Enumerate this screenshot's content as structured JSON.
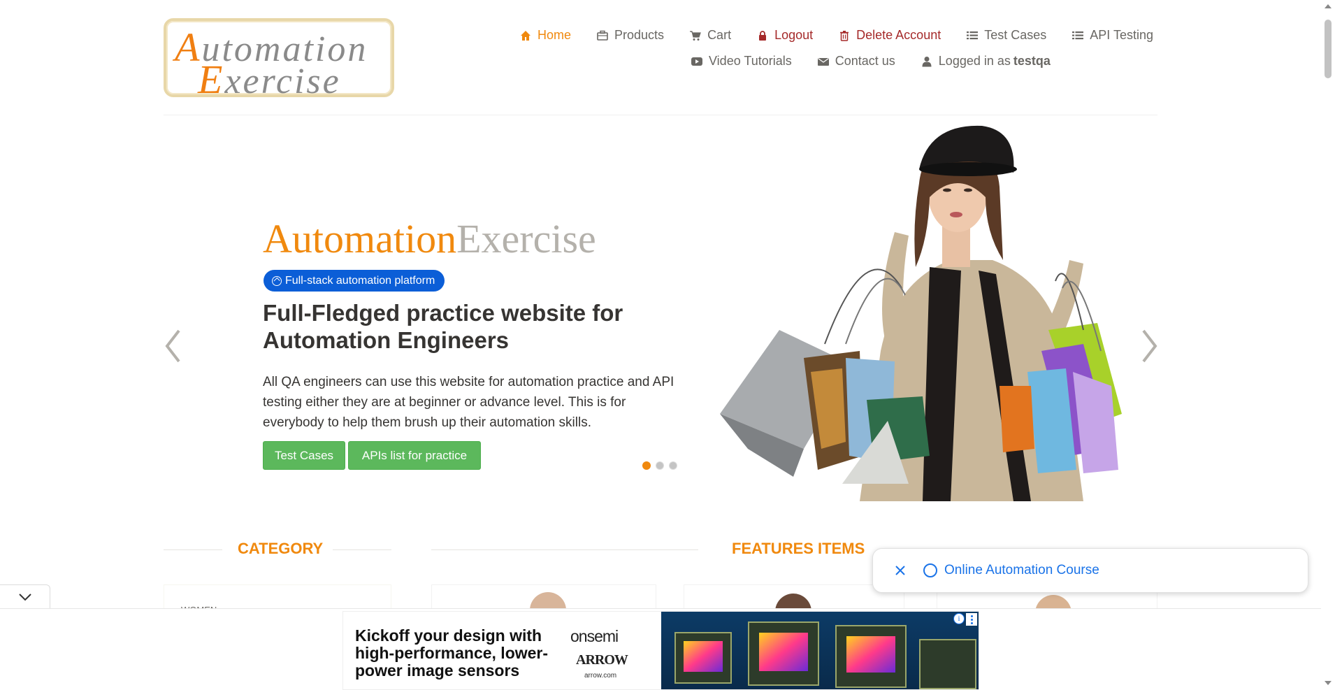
{
  "header": {
    "logo": {
      "line1_cap": "A",
      "line1_rest": "utomation",
      "line2_cap": "E",
      "line2_rest": "xercise"
    },
    "nav_row1": [
      {
        "label": "Home",
        "icon": "home-icon"
      },
      {
        "label": "Products",
        "icon": "briefcase-icon"
      },
      {
        "label": "Cart",
        "icon": "cart-icon"
      },
      {
        "label": "Logout",
        "icon": "lock-icon"
      },
      {
        "label": "Delete Account",
        "icon": "trash-icon"
      },
      {
        "label": "Test Cases",
        "icon": "list-icon"
      },
      {
        "label": "API Testing",
        "icon": "list-icon"
      }
    ],
    "nav_row2": [
      {
        "label": "Video Tutorials",
        "icon": "youtube-play-icon"
      },
      {
        "label": "Contact us",
        "icon": "envelope-icon"
      },
      {
        "label": "Logged in as",
        "icon": "user-icon",
        "username": "testqa"
      }
    ]
  },
  "hero": {
    "brand_a": "Automation",
    "brand_b": "Exercise",
    "badge": "Full-stack automation platform",
    "title": "Full-Fledged practice website for Automation Engineers",
    "description": "All QA engineers can use this website for automation practice and API testing either they are at beginner or advance level. This is for everybody to help them brush up their automation skills.",
    "btn_test_cases": "Test Cases",
    "btn_apis": "APIs list for practice",
    "slide_count": 3,
    "active_slide": 1
  },
  "sections": {
    "category": "CATEGORY",
    "features": "FEATURES ITEMS",
    "first_category": "WOMEN"
  },
  "floating": {
    "course_link": "Online Automation Course"
  },
  "ad": {
    "headline": "Kickoff your design with high-performance, lower-power image sensors",
    "brand1": "onsemi",
    "brand2": "ARROW",
    "brand2_url": "arrow.com",
    "info_glyph": "i"
  },
  "colors": {
    "accent": "#f0890e",
    "danger": "#a52a2a",
    "badge_blue": "#0b5ed7",
    "button_green": "#5cb85c",
    "link_blue": "#1a73e8"
  }
}
